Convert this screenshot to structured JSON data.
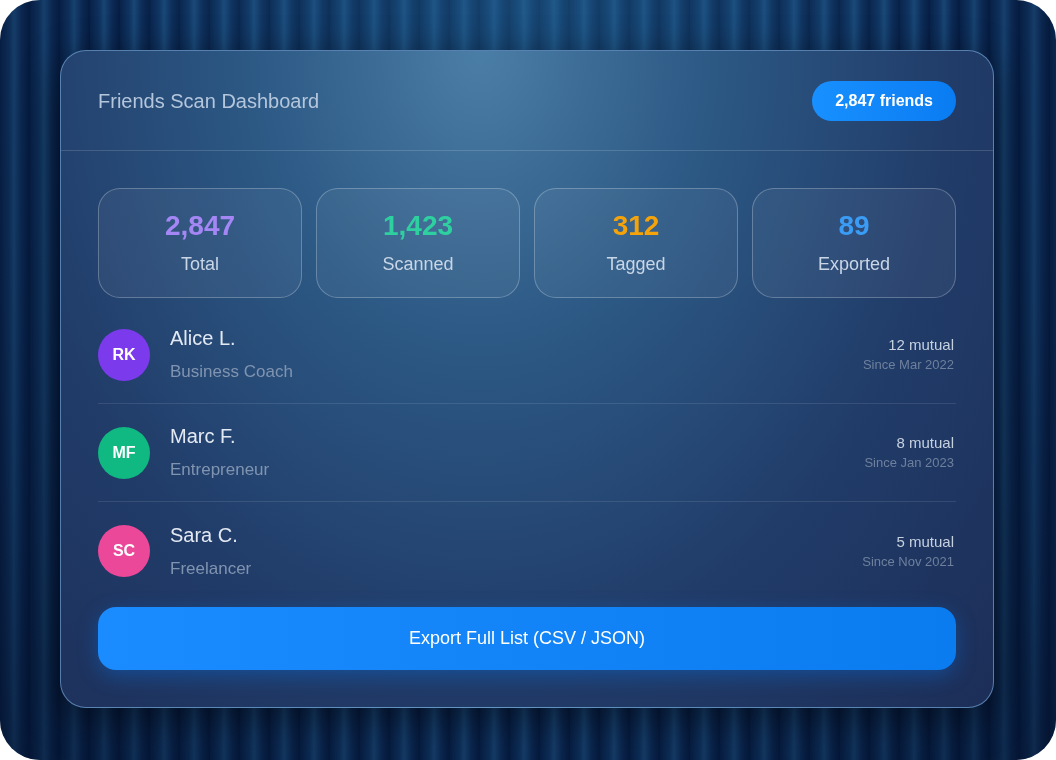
{
  "header": {
    "title": "Friends Scan Dashboard",
    "badge": "2,847 friends"
  },
  "stats": [
    {
      "value": "2,847",
      "label": "Total",
      "color": "#a586f5"
    },
    {
      "value": "1,423",
      "label": "Scanned",
      "color": "#2fd0a0"
    },
    {
      "value": "312",
      "label": "Tagged",
      "color": "#f5a30b"
    },
    {
      "value": "89",
      "label": "Exported",
      "color": "#3a9cf5"
    }
  ],
  "friends": [
    {
      "initials": "RK",
      "name": "Alice L.",
      "role": "Business Coach",
      "mutual": "12 mutual",
      "since": "Since Mar 2022",
      "color": "#7c3aed"
    },
    {
      "initials": "MF",
      "name": "Marc F.",
      "role": "Entrepreneur",
      "mutual": "8 mutual",
      "since": "Since Jan 2023",
      "color": "#10b981"
    },
    {
      "initials": "SC",
      "name": "Sara C.",
      "role": "Freelancer",
      "mutual": "5 mutual",
      "since": "Since Nov 2021",
      "color": "#ec4899"
    }
  ],
  "export_button": {
    "label": "Export Full List (CSV / JSON)"
  }
}
